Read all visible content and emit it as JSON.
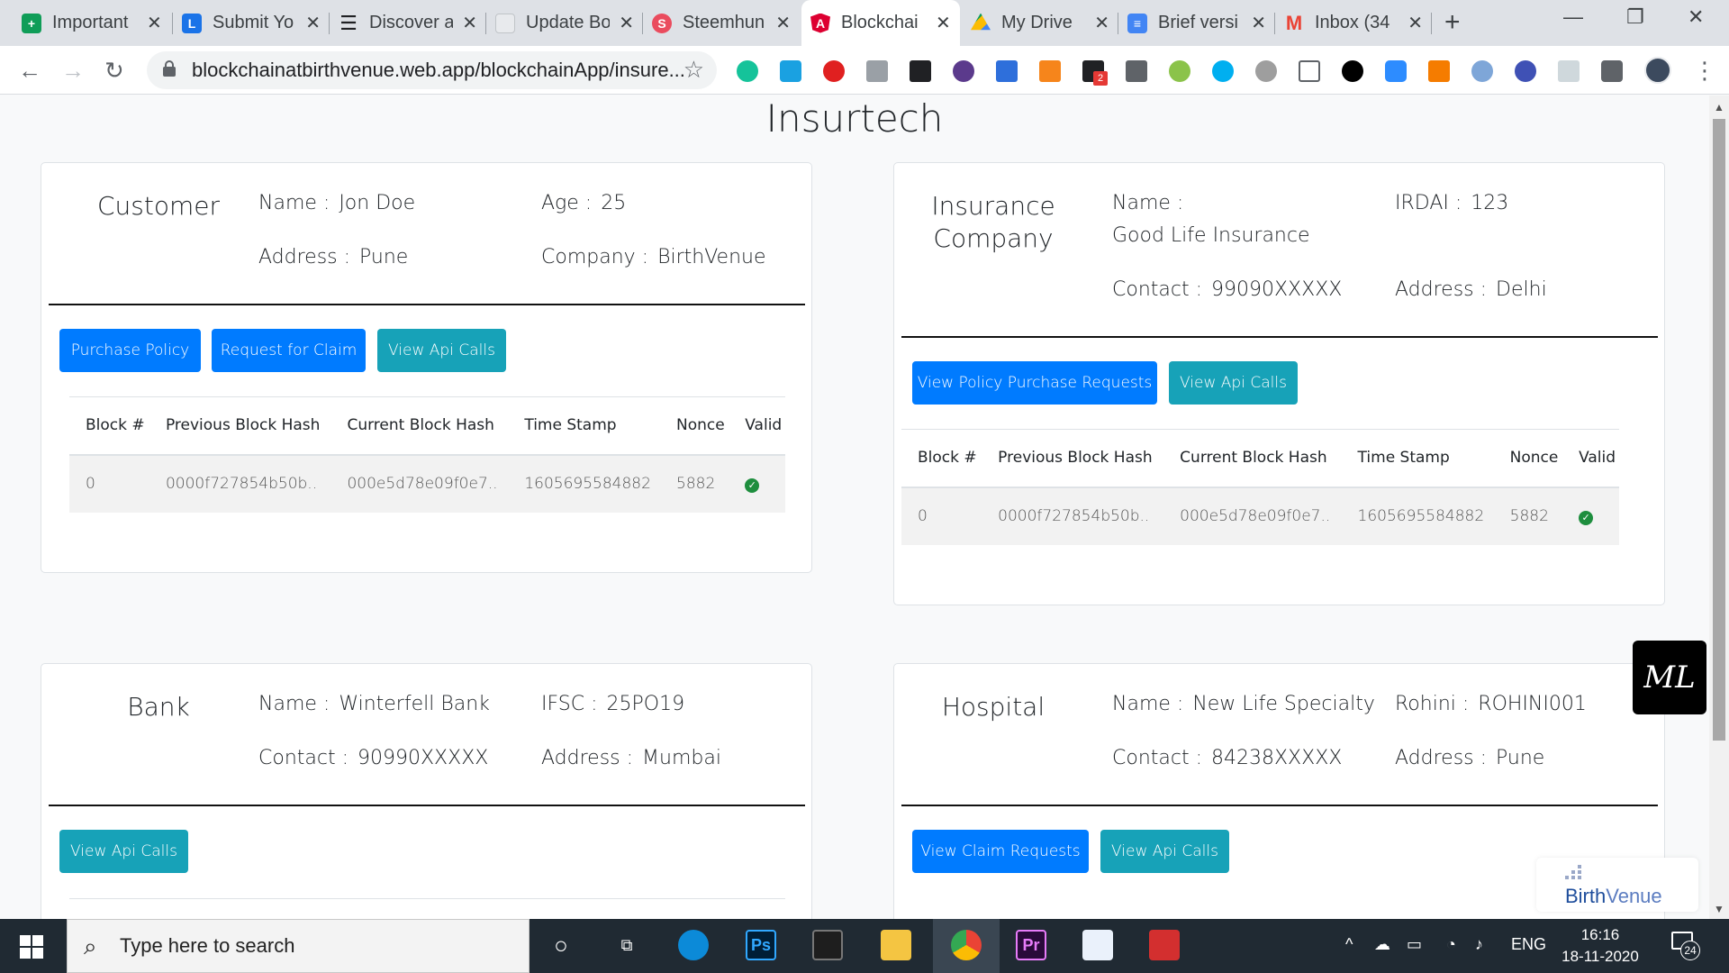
{
  "browser": {
    "tabs": [
      {
        "title": "Important",
        "favicon": "google-sheets-icon",
        "color": "#0f9d58"
      },
      {
        "title": "Submit Yo",
        "favicon": "l-app-icon",
        "color": "#1a73e8"
      },
      {
        "title": "Discover a",
        "favicon": "menu-lines-icon",
        "color": "#202124"
      },
      {
        "title": "Update Bo",
        "favicon": "page-icon",
        "color": "#e8eaed"
      },
      {
        "title": "Steemhun",
        "favicon": "steemhunt-icon",
        "color": "#ea4c5e"
      },
      {
        "title": "Blockchai",
        "favicon": "angular-icon",
        "color": "#dd0031"
      },
      {
        "title": "My Drive",
        "favicon": "google-drive-icon",
        "color": "#fbbc04"
      },
      {
        "title": "Brief versi",
        "favicon": "google-docs-icon",
        "color": "#4285f4"
      },
      {
        "title": "Inbox (34",
        "favicon": "gmail-icon",
        "color": "#ea4335"
      }
    ],
    "new_tab_label": "+",
    "url": "blockchainatbirthvenue.web.app/blockchainApp/insure...",
    "extension_badge": "2"
  },
  "page": {
    "title": "Insurtech",
    "customer": {
      "role": "Customer",
      "name_label": "Name :",
      "name": "Jon Doe",
      "age_label": "Age :",
      "age": "25",
      "address_label": "Address :",
      "address": "Pune",
      "company_label": "Company :",
      "company": "BirthVenue",
      "buttons": {
        "purchase": "Purchase Policy",
        "claim": "Request for Claim",
        "api": "View Api Calls"
      }
    },
    "insurer": {
      "role_line1": "Insurance",
      "role_line2": "Company",
      "name_label": "Name :",
      "name": "Good Life Insurance",
      "irdai_label": "IRDAI :",
      "irdai": "123",
      "contact_label": "Contact :",
      "contact": "99090XXXXX",
      "address_label": "Address :",
      "address": "Delhi",
      "buttons": {
        "requests": "View Policy Purchase Requests",
        "api": "View Api Calls"
      }
    },
    "bank": {
      "role": "Bank",
      "name_label": "Name :",
      "name": "Winterfell Bank",
      "ifsc_label": "IFSC :",
      "ifsc": "25PO19",
      "contact_label": "Contact :",
      "contact": "90990XXXXX",
      "address_label": "Address :",
      "address": "Mumbai",
      "buttons": {
        "api": "View Api Calls"
      }
    },
    "hospital": {
      "role": "Hospital",
      "name_label": "Name :",
      "name": "New Life Specialty",
      "rohini_label": "Rohini :",
      "rohini": "ROHINI001",
      "contact_label": "Contact :",
      "contact": "84238XXXXX",
      "address_label": "Address :",
      "address": "Pune",
      "buttons": {
        "claims": "View Claim Requests",
        "api": "View Api Calls"
      }
    },
    "ledger": {
      "headers": [
        "Block #",
        "Previous Block Hash",
        "Current Block Hash",
        "Time Stamp",
        "Nonce",
        "Valid"
      ],
      "row": {
        "block": "0",
        "prev_hash": "0000f727854b50b..",
        "curr_hash": "000e5d78e09f0e7..",
        "timestamp": "1605695584882",
        "nonce": "5882",
        "valid": "check-circle-icon"
      }
    },
    "widget_label": "ML",
    "logo": {
      "part1": "Birth",
      "part2": "Venue"
    }
  },
  "taskbar": {
    "search_placeholder": "Type here to search",
    "language": "ENG",
    "time": "16:16",
    "date": "18-11-2020",
    "notifications": "24"
  },
  "colors": {
    "primary": "#007bff",
    "info": "#17a2b8",
    "valid": "#1e8e3e"
  }
}
